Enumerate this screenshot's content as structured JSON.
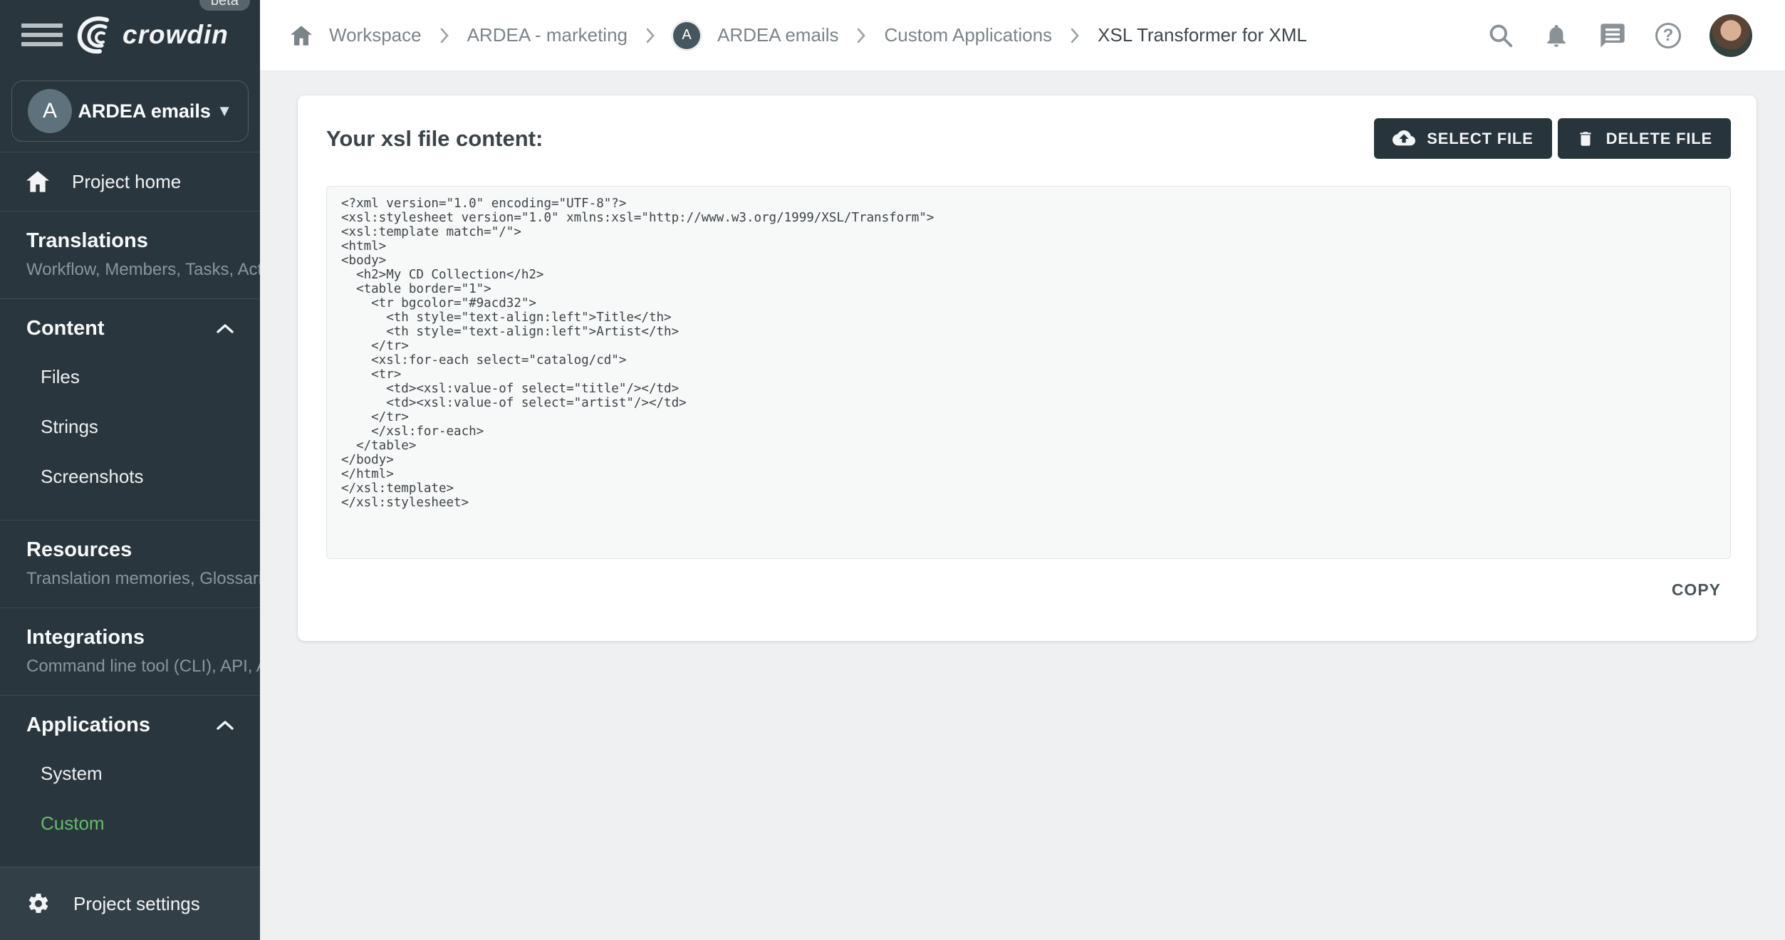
{
  "colors": {
    "sidebar_bg": "#2a363d",
    "sidebar_footer_bg": "#333f46",
    "accent_green": "#66bb6a",
    "dark_button": "#28343b",
    "page_bg": "#eef0f2"
  },
  "sidebar": {
    "logo": "crowdin",
    "beta": "beta",
    "project": {
      "initial": "A",
      "name": "ARDEA emails"
    },
    "home": "Project home",
    "translations": {
      "title": "Translations",
      "subtitle": "Workflow, Members, Tasks, Act…"
    },
    "content": {
      "title": "Content",
      "items": [
        "Files",
        "Strings",
        "Screenshots"
      ]
    },
    "resources": {
      "title": "Resources",
      "subtitle": "Translation memories, Glossari…"
    },
    "integrations": {
      "title": "Integrations",
      "subtitle": "Command line tool (CLI), API, A…"
    },
    "applications": {
      "title": "Applications",
      "items": [
        "System",
        "Custom"
      ]
    },
    "settings": "Project settings"
  },
  "topbar": {
    "breadcrumb": {
      "workspace": "Workspace",
      "org": "ARDEA - marketing",
      "project_initial": "A",
      "project": "ARDEA emails",
      "apps": "Custom Applications",
      "current": "XSL Transformer for XML"
    }
  },
  "main": {
    "heading": "Your xsl file content:",
    "select_file_label": "SELECT FILE",
    "delete_file_label": "DELETE FILE",
    "copy_label": "COPY",
    "code_lines": [
      "<?xml version=\"1.0\" encoding=\"UTF-8\"?>",
      "<xsl:stylesheet version=\"1.0\" xmlns:xsl=\"http://www.w3.org/1999/XSL/Transform\">",
      "<xsl:template match=\"/\">",
      "<html>",
      "<body>",
      "  <h2>My CD Collection</h2>",
      "  <table border=\"1\">",
      "    <tr bgcolor=\"#9acd32\">",
      "      <th style=\"text-align:left\">Title</th>",
      "      <th style=\"text-align:left\">Artist</th>",
      "    </tr>",
      "    <xsl:for-each select=\"catalog/cd\">",
      "    <tr>",
      "      <td><xsl:value-of select=\"title\"/></td>",
      "      <td><xsl:value-of select=\"artist\"/></td>",
      "    </tr>",
      "    </xsl:for-each>",
      "  </table>",
      "</body>",
      "</html>",
      "</xsl:template>",
      "</xsl:stylesheet>"
    ]
  }
}
